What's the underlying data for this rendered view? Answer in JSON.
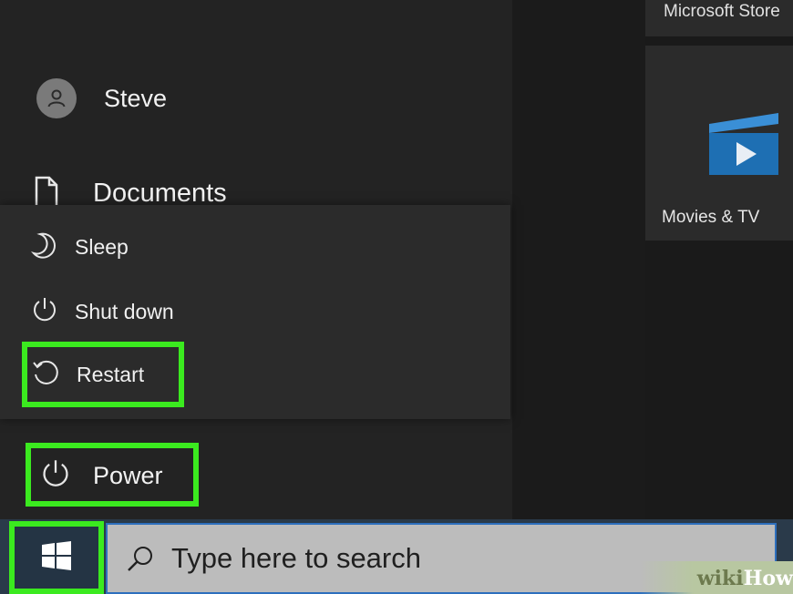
{
  "user": {
    "name": "Steve"
  },
  "sidebar": {
    "documents_label": "Documents"
  },
  "power_menu": {
    "items": [
      {
        "label": "Sleep",
        "icon": "moon-icon"
      },
      {
        "label": "Shut down",
        "icon": "power-icon"
      },
      {
        "label": "Restart",
        "icon": "restart-icon"
      }
    ]
  },
  "power_button": {
    "label": "Power",
    "icon": "power-icon"
  },
  "tiles": {
    "microsoft_store_label": "Microsoft Store",
    "movies_label": "Movies & TV"
  },
  "taskbar": {
    "start_icon": "windows-logo-icon",
    "search_placeholder": "Type here to search",
    "search_icon": "search-icon"
  },
  "watermark": {
    "part1": "wiki",
    "part2": "How"
  },
  "colors": {
    "highlight": "#3bea1f",
    "taskbar": "#2a3a4a",
    "search_border": "#2d6fbd",
    "movies_tile_icon": "#1e7fc8"
  }
}
